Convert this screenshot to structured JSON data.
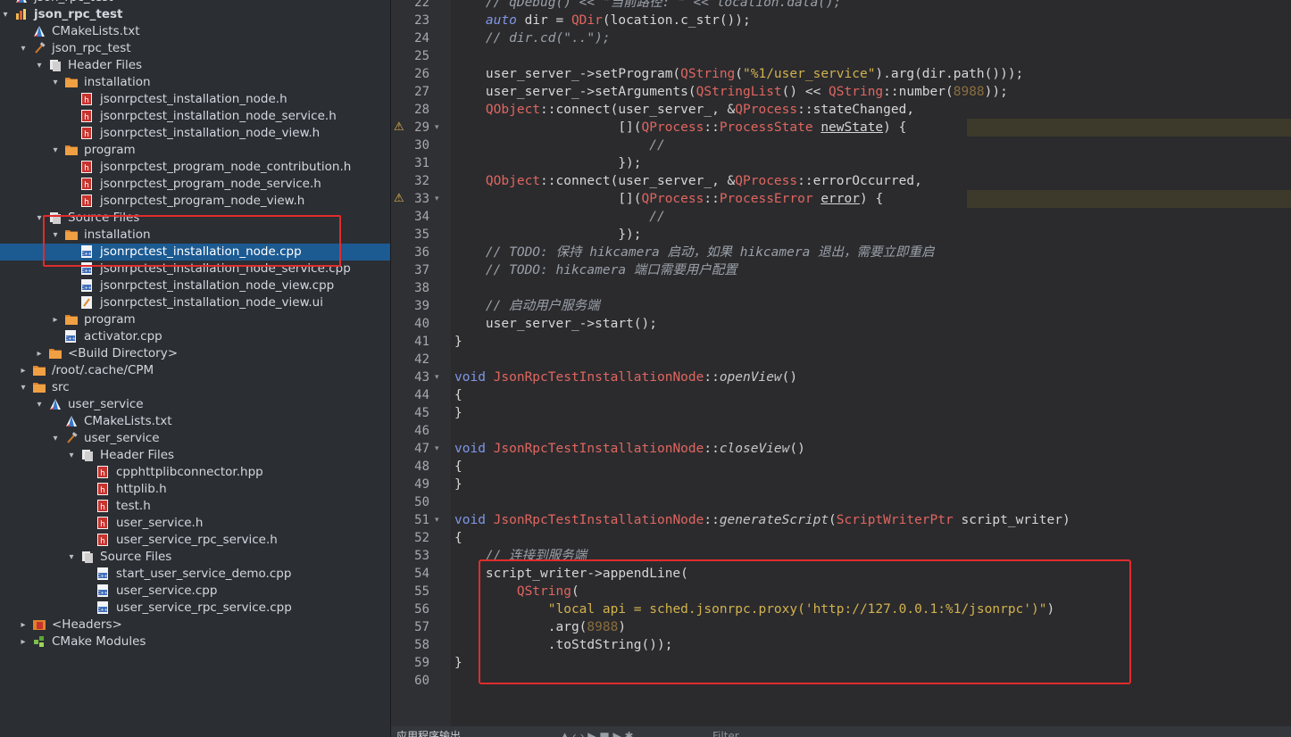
{
  "tree": [
    {
      "label": "json_rpc_test",
      "indent": 38,
      "arrow": "",
      "icon": "cmake",
      "selected": false,
      "bold": false
    },
    {
      "label": "json_rpc_test",
      "indent": 38,
      "arrow": "▾",
      "icon": "project",
      "selected": false,
      "bold": true
    },
    {
      "label": "CMakeLists.txt",
      "indent": 58,
      "arrow": "",
      "icon": "cmake",
      "selected": false,
      "bold": false
    },
    {
      "label": "json_rpc_test",
      "indent": 58,
      "arrow": "▾",
      "icon": "hammer",
      "selected": false,
      "bold": false
    },
    {
      "label": "Header Files",
      "indent": 76,
      "arrow": "▾",
      "icon": "group",
      "selected": false,
      "bold": false
    },
    {
      "label": "installation",
      "indent": 94,
      "arrow": "▾",
      "icon": "folder",
      "selected": false,
      "bold": false
    },
    {
      "label": "jsonrpctest_installation_node.h",
      "indent": 112,
      "arrow": "",
      "icon": "header",
      "selected": false,
      "bold": false
    },
    {
      "label": "jsonrpctest_installation_node_service.h",
      "indent": 112,
      "arrow": "",
      "icon": "header",
      "selected": false,
      "bold": false
    },
    {
      "label": "jsonrpctest_installation_node_view.h",
      "indent": 112,
      "arrow": "",
      "icon": "header",
      "selected": false,
      "bold": false
    },
    {
      "label": "program",
      "indent": 94,
      "arrow": "▾",
      "icon": "folder",
      "selected": false,
      "bold": false
    },
    {
      "label": "jsonrpctest_program_node_contribution.h",
      "indent": 112,
      "arrow": "",
      "icon": "header",
      "selected": false,
      "bold": false
    },
    {
      "label": "jsonrpctest_program_node_service.h",
      "indent": 112,
      "arrow": "",
      "icon": "header",
      "selected": false,
      "bold": false
    },
    {
      "label": "jsonrpctest_program_node_view.h",
      "indent": 112,
      "arrow": "",
      "icon": "header",
      "selected": false,
      "bold": false
    },
    {
      "label": "Source Files",
      "indent": 76,
      "arrow": "▾",
      "icon": "group",
      "selected": false,
      "bold": false
    },
    {
      "label": "installation",
      "indent": 94,
      "arrow": "▾",
      "icon": "folder",
      "selected": false,
      "bold": false
    },
    {
      "label": "jsonrpctest_installation_node.cpp",
      "indent": 112,
      "arrow": "",
      "icon": "cpp",
      "selected": true,
      "bold": false
    },
    {
      "label": "jsonrpctest_installation_node_service.cpp",
      "indent": 112,
      "arrow": "",
      "icon": "cpp",
      "selected": false,
      "bold": false
    },
    {
      "label": "jsonrpctest_installation_node_view.cpp",
      "indent": 112,
      "arrow": "",
      "icon": "cpp",
      "selected": false,
      "bold": false
    },
    {
      "label": "jsonrpctest_installation_node_view.ui",
      "indent": 112,
      "arrow": "",
      "icon": "ui",
      "selected": false,
      "bold": false
    },
    {
      "label": "program",
      "indent": 94,
      "arrow": "▸",
      "icon": "folder",
      "selected": false,
      "bold": false
    },
    {
      "label": "activator.cpp",
      "indent": 94,
      "arrow": "",
      "icon": "cpp",
      "selected": false,
      "bold": false
    },
    {
      "label": "<Build Directory>",
      "indent": 76,
      "arrow": "▸",
      "icon": "folder",
      "selected": false,
      "bold": false
    },
    {
      "label": "/root/.cache/CPM",
      "indent": 58,
      "arrow": "▸",
      "icon": "folder",
      "selected": false,
      "bold": false
    },
    {
      "label": "src",
      "indent": 58,
      "arrow": "▾",
      "icon": "folder",
      "selected": false,
      "bold": false
    },
    {
      "label": "user_service",
      "indent": 76,
      "arrow": "▾",
      "icon": "cmake",
      "selected": false,
      "bold": false
    },
    {
      "label": "CMakeLists.txt",
      "indent": 94,
      "arrow": "",
      "icon": "cmake",
      "selected": false,
      "bold": false
    },
    {
      "label": "user_service",
      "indent": 94,
      "arrow": "▾",
      "icon": "hammer",
      "selected": false,
      "bold": false
    },
    {
      "label": "Header Files",
      "indent": 112,
      "arrow": "▾",
      "icon": "group",
      "selected": false,
      "bold": false
    },
    {
      "label": "cpphttplibconnector.hpp",
      "indent": 130,
      "arrow": "",
      "icon": "header",
      "selected": false,
      "bold": false
    },
    {
      "label": "httplib.h",
      "indent": 130,
      "arrow": "",
      "icon": "header",
      "selected": false,
      "bold": false
    },
    {
      "label": "test.h",
      "indent": 130,
      "arrow": "",
      "icon": "header",
      "selected": false,
      "bold": false
    },
    {
      "label": "user_service.h",
      "indent": 130,
      "arrow": "",
      "icon": "header",
      "selected": false,
      "bold": false
    },
    {
      "label": "user_service_rpc_service.h",
      "indent": 130,
      "arrow": "",
      "icon": "header",
      "selected": false,
      "bold": false
    },
    {
      "label": "Source Files",
      "indent": 112,
      "arrow": "▾",
      "icon": "group",
      "selected": false,
      "bold": false
    },
    {
      "label": "start_user_service_demo.cpp",
      "indent": 130,
      "arrow": "",
      "icon": "cpp",
      "selected": false,
      "bold": false
    },
    {
      "label": "user_service.cpp",
      "indent": 130,
      "arrow": "",
      "icon": "cpp",
      "selected": false,
      "bold": false
    },
    {
      "label": "user_service_rpc_service.cpp",
      "indent": 130,
      "arrow": "",
      "icon": "cpp",
      "selected": false,
      "bold": false
    },
    {
      "label": "<Headers>",
      "indent": 58,
      "arrow": "▸",
      "icon": "headers-group",
      "selected": false,
      "bold": false
    },
    {
      "label": "CMake Modules",
      "indent": 58,
      "arrow": "▸",
      "icon": "modules",
      "selected": false,
      "bold": false
    }
  ],
  "code": [
    {
      "n": "22",
      "fold": false,
      "warn": false,
      "hl": false,
      "spans": [
        [
          "cm",
          "    // qDebug() << \"当前路径: \" << location.data();"
        ]
      ]
    },
    {
      "n": "23",
      "fold": false,
      "warn": false,
      "hl": false,
      "spans": [
        [
          "",
          "    "
        ],
        [
          "ki",
          "auto"
        ],
        [
          "",
          " dir = "
        ],
        [
          "ty",
          "QDir"
        ],
        [
          "",
          "(location.c_str());"
        ]
      ]
    },
    {
      "n": "24",
      "fold": false,
      "warn": false,
      "hl": false,
      "spans": [
        [
          "cm",
          "    // dir.cd(\"..\");"
        ]
      ]
    },
    {
      "n": "25",
      "fold": false,
      "warn": false,
      "hl": false,
      "spans": []
    },
    {
      "n": "26",
      "fold": false,
      "warn": false,
      "hl": false,
      "spans": [
        [
          "",
          "    user_server_->setProgram("
        ],
        [
          "ty",
          "QString"
        ],
        [
          "",
          "("
        ],
        [
          "st",
          "\"%1/user_service\""
        ],
        [
          "",
          ").arg(dir.path()));"
        ]
      ]
    },
    {
      "n": "27",
      "fold": false,
      "warn": false,
      "hl": false,
      "spans": [
        [
          "",
          "    user_server_->setArguments("
        ],
        [
          "ty",
          "QStringList"
        ],
        [
          "",
          "() << "
        ],
        [
          "ty",
          "QString"
        ],
        [
          "",
          "::number("
        ],
        [
          "nm",
          "8988"
        ],
        [
          "",
          "));"
        ]
      ]
    },
    {
      "n": "28",
      "fold": false,
      "warn": false,
      "hl": false,
      "spans": [
        [
          "",
          "    "
        ],
        [
          "ty",
          "QObject"
        ],
        [
          "",
          "::connect(user_server_, &"
        ],
        [
          "ty",
          "QProcess"
        ],
        [
          "",
          "::stateChanged,"
        ]
      ]
    },
    {
      "n": "29",
      "fold": true,
      "warn": true,
      "hl": true,
      "spans": [
        [
          "",
          "                     []("
        ],
        [
          "ty",
          "QProcess"
        ],
        [
          "",
          "::"
        ],
        [
          "ty",
          "ProcessState"
        ],
        [
          "",
          " "
        ],
        [
          "ul",
          "newState"
        ],
        [
          "",
          ") {"
        ]
      ]
    },
    {
      "n": "30",
      "fold": false,
      "warn": false,
      "hl": false,
      "spans": [
        [
          "cm",
          "                         //"
        ]
      ]
    },
    {
      "n": "31",
      "fold": false,
      "warn": false,
      "hl": false,
      "spans": [
        [
          "",
          "                     });"
        ]
      ]
    },
    {
      "n": "32",
      "fold": false,
      "warn": false,
      "hl": false,
      "spans": [
        [
          "",
          "    "
        ],
        [
          "ty",
          "QObject"
        ],
        [
          "",
          "::connect(user_server_, &"
        ],
        [
          "ty",
          "QProcess"
        ],
        [
          "",
          "::errorOccurred,"
        ]
      ]
    },
    {
      "n": "33",
      "fold": true,
      "warn": true,
      "hl": true,
      "spans": [
        [
          "",
          "                     []("
        ],
        [
          "ty",
          "QProcess"
        ],
        [
          "",
          "::"
        ],
        [
          "ty",
          "ProcessError"
        ],
        [
          "",
          " "
        ],
        [
          "ul",
          "error"
        ],
        [
          "",
          ") {"
        ]
      ]
    },
    {
      "n": "34",
      "fold": false,
      "warn": false,
      "hl": false,
      "spans": [
        [
          "cm",
          "                         //"
        ]
      ]
    },
    {
      "n": "35",
      "fold": false,
      "warn": false,
      "hl": false,
      "spans": [
        [
          "",
          "                     });"
        ]
      ]
    },
    {
      "n": "36",
      "fold": false,
      "warn": false,
      "hl": false,
      "spans": [
        [
          "cm",
          "    // TODO: 保持 hikcamera 启动，如果 hikcamera 退出，需要立即重启"
        ]
      ]
    },
    {
      "n": "37",
      "fold": false,
      "warn": false,
      "hl": false,
      "spans": [
        [
          "cm",
          "    // TODO: hikcamera 端口需要用户配置"
        ]
      ]
    },
    {
      "n": "38",
      "fold": false,
      "warn": false,
      "hl": false,
      "spans": []
    },
    {
      "n": "39",
      "fold": false,
      "warn": false,
      "hl": false,
      "spans": [
        [
          "cm",
          "    // 启动用户服务端"
        ]
      ]
    },
    {
      "n": "40",
      "fold": false,
      "warn": false,
      "hl": false,
      "spans": [
        [
          "",
          "    user_server_->start();"
        ]
      ]
    },
    {
      "n": "41",
      "fold": false,
      "warn": false,
      "hl": false,
      "spans": [
        [
          "",
          "}"
        ]
      ]
    },
    {
      "n": "42",
      "fold": false,
      "warn": false,
      "hl": false,
      "spans": []
    },
    {
      "n": "43",
      "fold": true,
      "warn": false,
      "hl": false,
      "spans": [
        [
          "k",
          "void"
        ],
        [
          "",
          " "
        ],
        [
          "ty",
          "JsonRpcTestInstallationNode"
        ],
        [
          "",
          "::"
        ],
        [
          "fn",
          "openView"
        ],
        [
          "",
          "()"
        ]
      ]
    },
    {
      "n": "44",
      "fold": false,
      "warn": false,
      "hl": false,
      "spans": [
        [
          "",
          "{"
        ]
      ]
    },
    {
      "n": "45",
      "fold": false,
      "warn": false,
      "hl": false,
      "spans": [
        [
          "",
          "}"
        ]
      ]
    },
    {
      "n": "46",
      "fold": false,
      "warn": false,
      "hl": false,
      "spans": []
    },
    {
      "n": "47",
      "fold": true,
      "warn": false,
      "hl": false,
      "spans": [
        [
          "k",
          "void"
        ],
        [
          "",
          " "
        ],
        [
          "ty",
          "JsonRpcTestInstallationNode"
        ],
        [
          "",
          "::"
        ],
        [
          "fn",
          "closeView"
        ],
        [
          "",
          "()"
        ]
      ]
    },
    {
      "n": "48",
      "fold": false,
      "warn": false,
      "hl": false,
      "spans": [
        [
          "",
          "{"
        ]
      ]
    },
    {
      "n": "49",
      "fold": false,
      "warn": false,
      "hl": false,
      "spans": [
        [
          "",
          "}"
        ]
      ]
    },
    {
      "n": "50",
      "fold": false,
      "warn": false,
      "hl": false,
      "spans": []
    },
    {
      "n": "51",
      "fold": true,
      "warn": false,
      "hl": false,
      "spans": [
        [
          "k",
          "void"
        ],
        [
          "",
          " "
        ],
        [
          "ty",
          "JsonRpcTestInstallationNode"
        ],
        [
          "",
          "::"
        ],
        [
          "fn",
          "generateScript"
        ],
        [
          "",
          "("
        ],
        [
          "ty",
          "ScriptWriterPtr"
        ],
        [
          "",
          " script_writer)"
        ]
      ]
    },
    {
      "n": "52",
      "fold": false,
      "warn": false,
      "hl": false,
      "spans": [
        [
          "",
          "{"
        ]
      ]
    },
    {
      "n": "53",
      "fold": false,
      "warn": false,
      "hl": false,
      "spans": [
        [
          "cm",
          "    // 连接到服务端"
        ]
      ]
    },
    {
      "n": "54",
      "fold": false,
      "warn": false,
      "hl": false,
      "spans": [
        [
          "",
          "    script_writer->appendLine("
        ]
      ]
    },
    {
      "n": "55",
      "fold": false,
      "warn": false,
      "hl": false,
      "spans": [
        [
          "",
          "        "
        ],
        [
          "ty",
          "QString"
        ],
        [
          "",
          "("
        ]
      ]
    },
    {
      "n": "56",
      "fold": false,
      "warn": false,
      "hl": false,
      "spans": [
        [
          "",
          "            "
        ],
        [
          "st",
          "\"local api = sched.jsonrpc.proxy('http://127.0.0.1:%1/jsonrpc')\""
        ],
        [
          "",
          ")"
        ]
      ]
    },
    {
      "n": "57",
      "fold": false,
      "warn": false,
      "hl": false,
      "spans": [
        [
          "",
          "            .arg("
        ],
        [
          "nm",
          "8988"
        ],
        [
          "",
          ")"
        ]
      ]
    },
    {
      "n": "58",
      "fold": false,
      "warn": false,
      "hl": false,
      "spans": [
        [
          "",
          "            .toStdString());"
        ]
      ]
    },
    {
      "n": "59",
      "fold": false,
      "warn": false,
      "hl": false,
      "spans": [
        [
          "",
          "}"
        ]
      ]
    },
    {
      "n": "60",
      "fold": false,
      "warn": false,
      "hl": false,
      "spans": []
    }
  ],
  "bottom": {
    "output_tab": "应用程序输出",
    "filter_placeholder": "Filter"
  },
  "colors": {
    "accent": "#1c5a92",
    "annotation_red": "#e12c2c"
  }
}
